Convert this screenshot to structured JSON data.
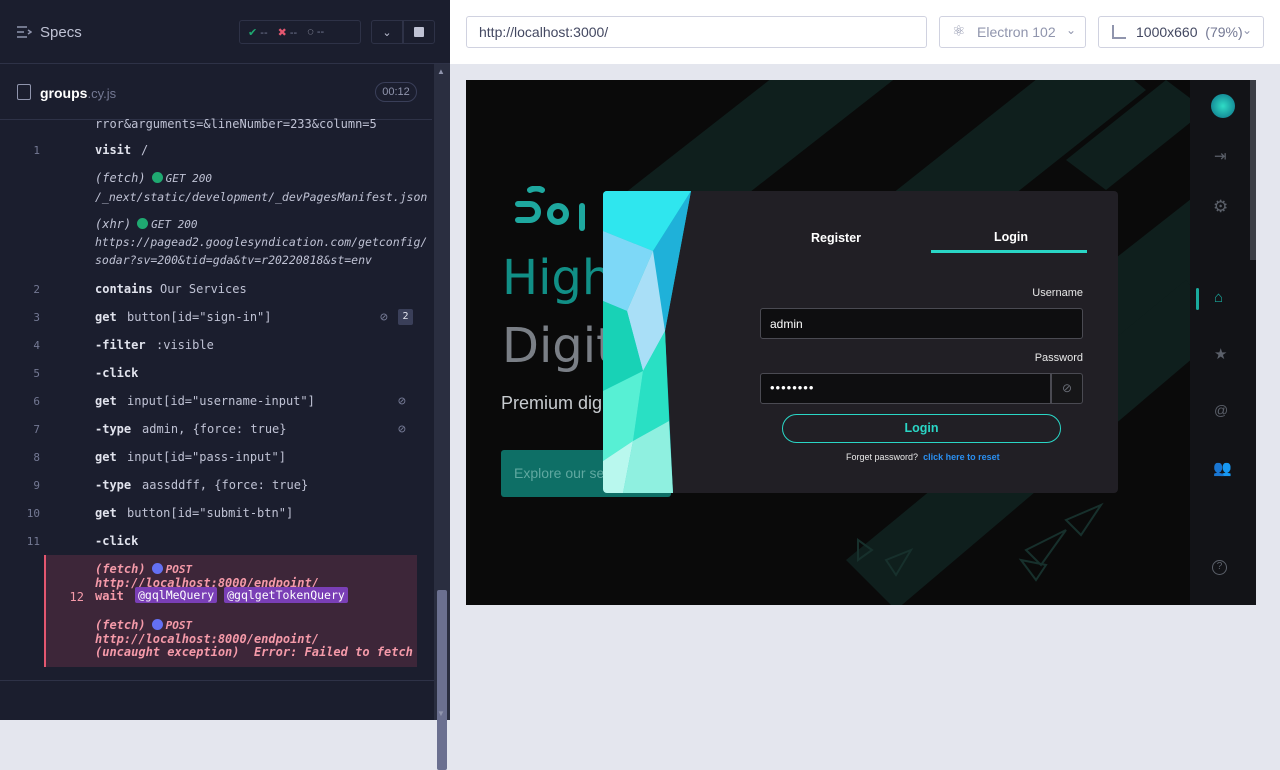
{
  "runner": {
    "specs_label": "Specs",
    "stats": {
      "passed": "--",
      "failed": "--",
      "pending": "--"
    },
    "spec_file": {
      "name": "groups",
      "ext": ".cy.js",
      "duration": "00:12"
    },
    "commands": {
      "truncated_line": "rror&arguments=&lineNumber=233&column=5",
      "c1": {
        "num": "1",
        "name": "visit",
        "msg": "/"
      },
      "fetch1": {
        "type": "(fetch)",
        "status": "GET 200",
        "url": "/_next/static/development/_devPagesManifest.json"
      },
      "xhr1": {
        "type": "(xhr)",
        "status": "GET 200",
        "url1": "https://pagead2.googlesyndication.com/getconfig/",
        "url2": "sodar?sv=200&tid=gda&tv=r20220818&st=env"
      },
      "c2": {
        "num": "2",
        "name": "contains",
        "msg": "Our Services"
      },
      "c3": {
        "num": "3",
        "name": "get",
        "msg": "button[id=\"sign-in\"]",
        "badge": "2"
      },
      "c4": {
        "num": "4",
        "name": "-filter",
        "msg": ":visible"
      },
      "c5": {
        "num": "5",
        "name": "-click",
        "msg": ""
      },
      "c6": {
        "num": "6",
        "name": "get",
        "msg": "input[id=\"username-input\"]"
      },
      "c7": {
        "num": "7",
        "name": "-type",
        "msg": "admin, {force: true}"
      },
      "c8": {
        "num": "8",
        "name": "get",
        "msg": "input[id=\"pass-input\"]"
      },
      "c9": {
        "num": "9",
        "name": "-type",
        "msg": "aassddff, {force: true}"
      },
      "c10": {
        "num": "10",
        "name": "get",
        "msg": "button[id=\"submit-btn\"]"
      },
      "c11": {
        "num": "11",
        "name": "-click",
        "msg": ""
      },
      "err_fetch1": {
        "type": "(fetch)",
        "method": "POST",
        "url": "http://localhost:8000/endpoint/"
      },
      "c12": {
        "num": "12",
        "name": "wait",
        "alias1": "@gqlMeQuery",
        "alias2": "@gqlgetTokenQuery"
      },
      "err_fetch2": {
        "type": "(fetch)",
        "method": "POST",
        "url": "http://localhost:8000/endpoint/"
      },
      "exception": {
        "type": "(uncaught exception)",
        "msg": "Error: Failed to fetch"
      }
    }
  },
  "browser_bar": {
    "url": "http://localhost:3000/",
    "browser": "Electron 102",
    "viewport": "1000x660",
    "scale": "(79%)"
  },
  "app": {
    "hero_line1": "High",
    "hero_line2": "Digit",
    "hero_sub": "Premium dig",
    "hero_cta": "Explore our se",
    "modal": {
      "tab_register": "Register",
      "tab_login": "Login",
      "username_label": "Username",
      "username_value": "admin",
      "password_label": "Password",
      "password_value": "••••••••",
      "login_button": "Login",
      "forgot_text": "Forget password?",
      "forgot_link": "click here to reset"
    }
  },
  "colors": {
    "accent": "#1ccfc0",
    "panel": "#1b1e2e",
    "error": "#e45770",
    "alias": "#7a3fb6"
  }
}
